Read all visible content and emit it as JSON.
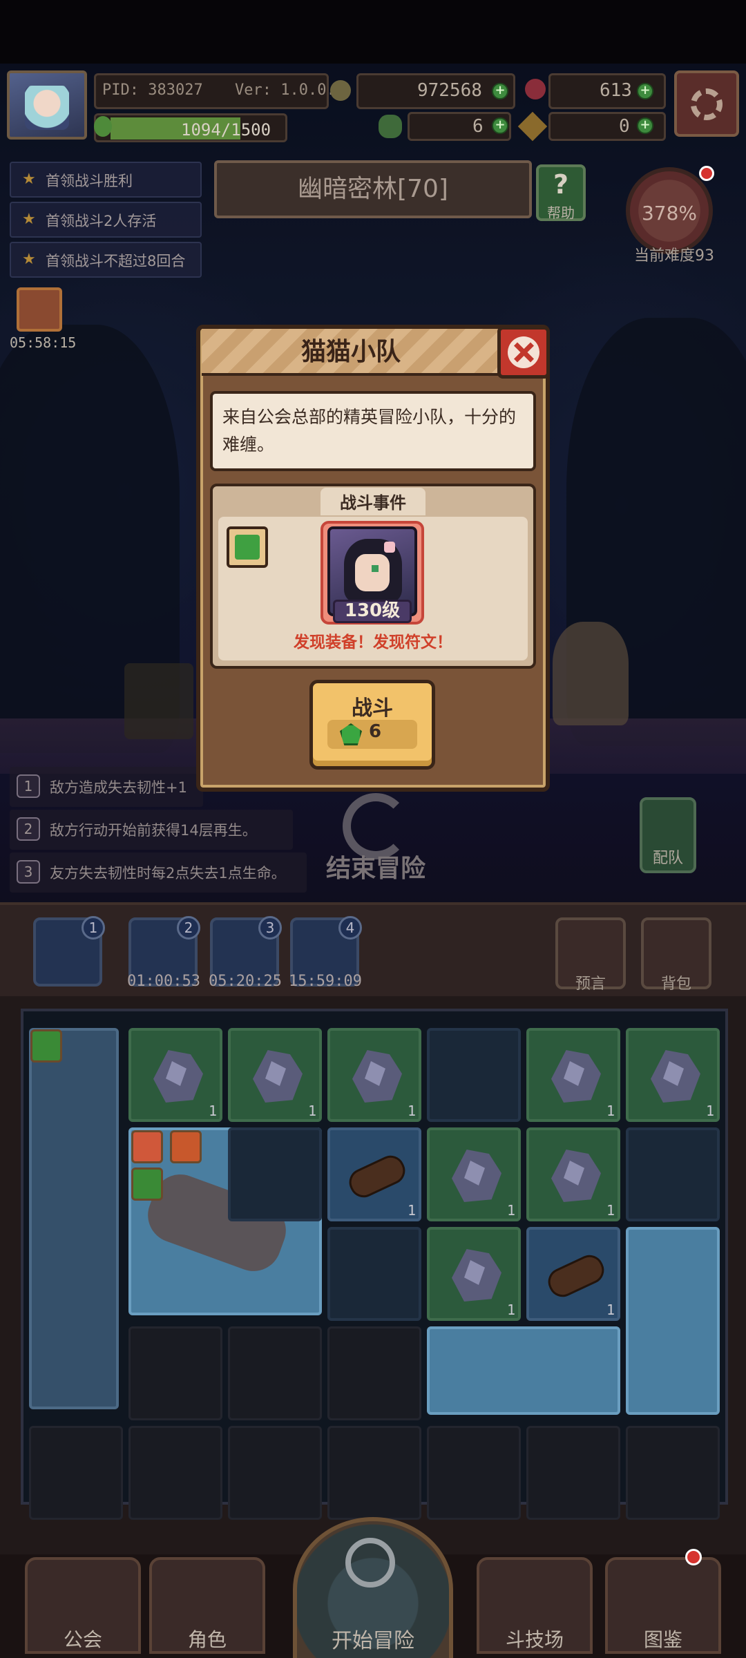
{
  "header": {
    "pid": "PID: 383027",
    "version": "Ver: 1.0.0.8",
    "gold": "972568",
    "gems": "613",
    "xp": "1094/1500",
    "xp_fraction": 0.729,
    "clover": "6",
    "keys": "0"
  },
  "objectives": [
    "首领战斗胜利",
    "首领战斗2人存活",
    "首领战斗不超过8回合"
  ],
  "stage": {
    "name": "幽暗密林[70]",
    "help_label": "帮助",
    "difficulty_pct": "378%",
    "difficulty_label": "当前难度93"
  },
  "chest_timer": "05:58:15",
  "modifiers": [
    {
      "num": "1",
      "text": "敌方造成失去韧性+1"
    },
    {
      "num": "2",
      "text": "敌方行动开始前获得14层再生。"
    },
    {
      "num": "3",
      "text": "友方失去韧性时每2点失去1点生命。"
    }
  ],
  "end_adventure_label": "结束冒险",
  "team_label": "配队",
  "slots": [
    {
      "num": "1",
      "timer": ""
    },
    {
      "num": "2",
      "timer": "01:00:53"
    },
    {
      "num": "3",
      "timer": "05:20:25"
    },
    {
      "num": "4",
      "timer": "15:59:09"
    }
  ],
  "side_buttons": {
    "prophecy": "预言",
    "backpack": "背包"
  },
  "grid_count": "1",
  "nav": {
    "guild": "公会",
    "character": "角色",
    "start": "开始冒险",
    "arena": "斗技场",
    "codex": "图鉴"
  },
  "modal": {
    "title": "猫猫小队",
    "description": "来自公会总部的精英冒险小队，十分的难缠。",
    "event_title": "战斗事件",
    "enemy_level": "130级",
    "rewards": "发现装备！发现符文！",
    "fight_label": "战斗",
    "fight_cost": "6"
  },
  "colors": {
    "accent_gold": "#f2c26a",
    "danger_red": "#c2372c",
    "xp_green": "#5d8c3b"
  }
}
